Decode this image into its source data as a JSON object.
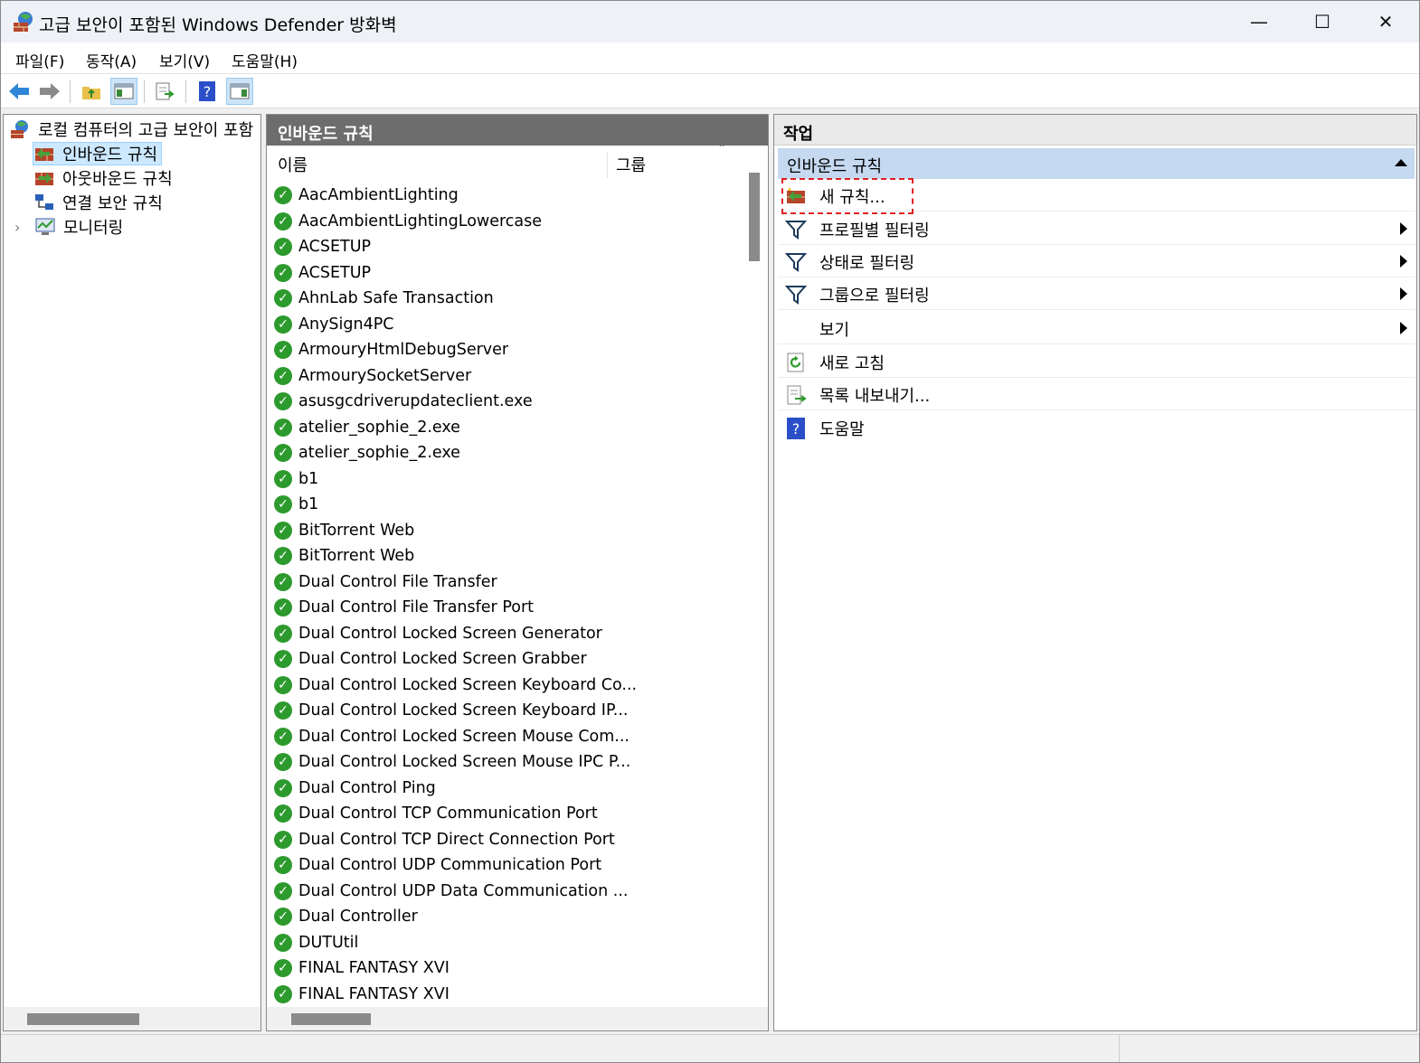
{
  "window": {
    "title": "고급 보안이 포함된 Windows Defender 방화벽",
    "minimize": "—",
    "maximize": "☐",
    "close": "✕"
  },
  "menu": [
    "파일(F)",
    "동작(A)",
    "보기(V)",
    "도움말(H)"
  ],
  "tree": {
    "root": "로컬 컴퓨터의 고급 보안이 포함",
    "items": [
      "인바운드 규칙",
      "아웃바운드 규칙",
      "연결 보안 규칙",
      "모니터링"
    ],
    "expander": "›"
  },
  "middle": {
    "title": "인바운드 규칙",
    "columns": {
      "name": "이름",
      "group": "그룹"
    },
    "sort_glyph": "ˆ",
    "rows": [
      "AacAmbientLighting",
      "AacAmbientLightingLowercase",
      "ACSETUP",
      "ACSETUP",
      "AhnLab Safe Transaction",
      "AnySign4PC",
      "ArmouryHtmlDebugServer",
      "ArmourySocketServer",
      "asusgcdriverupdateclient.exe",
      "atelier_sophie_2.exe",
      "atelier_sophie_2.exe",
      "b1",
      "b1",
      "BitTorrent Web",
      "BitTorrent Web",
      "Dual Control File Transfer",
      "Dual Control File Transfer Port",
      "Dual Control Locked Screen Generator",
      "Dual Control Locked Screen Grabber",
      "Dual Control Locked Screen Keyboard Co...",
      "Dual Control Locked Screen Keyboard IP...",
      "Dual Control Locked Screen Mouse Com...",
      "Dual Control Locked Screen Mouse IPC P...",
      "Dual Control Ping",
      "Dual Control TCP Communication Port",
      "Dual Control TCP Direct Connection Port",
      "Dual Control UDP Communication Port",
      "Dual Control UDP Data Communication ...",
      "Dual Controller",
      "DUTUtil",
      "FINAL FANTASY XVI",
      "FINAL FANTASY XVI"
    ]
  },
  "actions": {
    "title": "작업",
    "section": "인바운드 규칙",
    "items": [
      "새 규칙...",
      "프로필별 필터링",
      "상태로 필터링",
      "그룹으로 필터링",
      "보기",
      "새로 고침",
      "목록 내보내기...",
      "도움말"
    ]
  },
  "colors": {
    "accent": "#cce8ff",
    "section": "#c5d9f1",
    "header": "#6d6d6d",
    "check": "#2d9a2d",
    "highlight": "#e02020"
  }
}
